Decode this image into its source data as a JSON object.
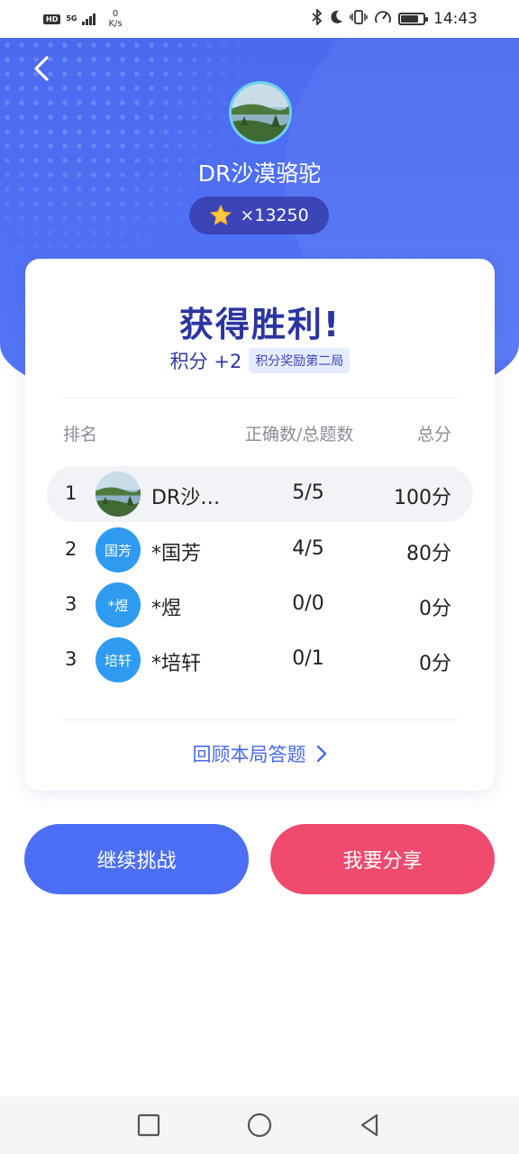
{
  "status_bar": {
    "hd_label": "HD",
    "network_label": "5G",
    "net_speed_value": "0",
    "net_speed_unit": "K/s",
    "battery_level": 0.8,
    "time": "14:43"
  },
  "header": {
    "back_icon": "chevron-left-icon",
    "user_name": "DR沙漠骆驼",
    "star_icon": "star-icon",
    "star_count": "×13250"
  },
  "result": {
    "title": "获得胜利!",
    "points": "积分 +2",
    "reward_badge": "积分奖励第二局"
  },
  "table": {
    "headers": {
      "rank": "排名",
      "correct": "正确数/总题数",
      "score": "总分"
    },
    "rows": [
      {
        "rank": "1",
        "avatar_text": "",
        "name": "DR沙…",
        "correct": "5/5",
        "score": "100分",
        "is_me": true
      },
      {
        "rank": "2",
        "avatar_text": "国芳",
        "name": "*国芳",
        "correct": "4/5",
        "score": "80分",
        "is_me": false
      },
      {
        "rank": "3",
        "avatar_text": "*煜",
        "name": "*煜",
        "correct": "0/0",
        "score": "0分",
        "is_me": false
      },
      {
        "rank": "3",
        "avatar_text": "培轩",
        "name": "*培轩",
        "correct": "0/1",
        "score": "0分",
        "is_me": false
      }
    ]
  },
  "review_link": "回顾本局答题",
  "buttons": {
    "continue": "继续挑战",
    "share": "我要分享"
  },
  "colors": {
    "primary_blue": "#4b6ef5",
    "share_pink": "#f04a6e",
    "title_navy": "#2b35a0",
    "avatar_blue": "#2e9bf0"
  },
  "nav": {
    "icons": [
      "square-icon",
      "circle-icon",
      "triangle-back-icon"
    ]
  }
}
